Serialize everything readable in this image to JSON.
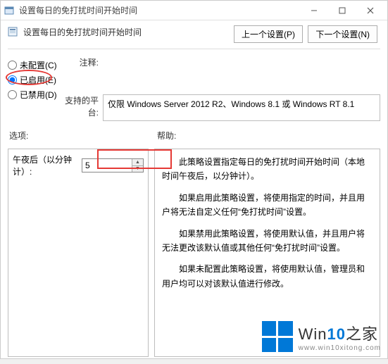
{
  "window": {
    "title": "设置每日的免打扰时间开始时间",
    "subtitle": "设置每日的免打扰时间开始时间"
  },
  "nav": {
    "prev": "上一个设置(P)",
    "next": "下一个设置(N)"
  },
  "radio": {
    "not_configured": "未配置(C)",
    "enabled": "已启用(E)",
    "disabled": "已禁用(D)",
    "selected": "enabled"
  },
  "meta": {
    "comment_label": "注释:",
    "comment_value": "",
    "platform_label": "支持的平台:",
    "platform_value": "仅限 Windows Server 2012 R2、Windows 8.1 或 Windows RT 8.1"
  },
  "labels": {
    "options": "选项:",
    "help": "帮助:"
  },
  "option": {
    "minutes_label": "午夜后（以分钟计）:",
    "minutes_value": "5"
  },
  "help_paragraphs": [
    "此策略设置指定每日的免打扰时间开始时间（本地时间午夜后，以分钟计）。",
    "如果启用此策略设置，将使用指定的时间，并且用户将无法自定义任何“免打扰时间”设置。",
    "如果禁用此策略设置，将使用默认值，并且用户将无法更改该默认值或其他任何“免打扰时间”设置。",
    "如果未配置此策略设置，将使用默认值，管理员和用户均可以对该默认值进行修改。"
  ],
  "watermark": {
    "brand_prefix": "Win",
    "brand_accent": "10",
    "brand_suffix": "之家",
    "url": "www.win10xitong.com"
  }
}
